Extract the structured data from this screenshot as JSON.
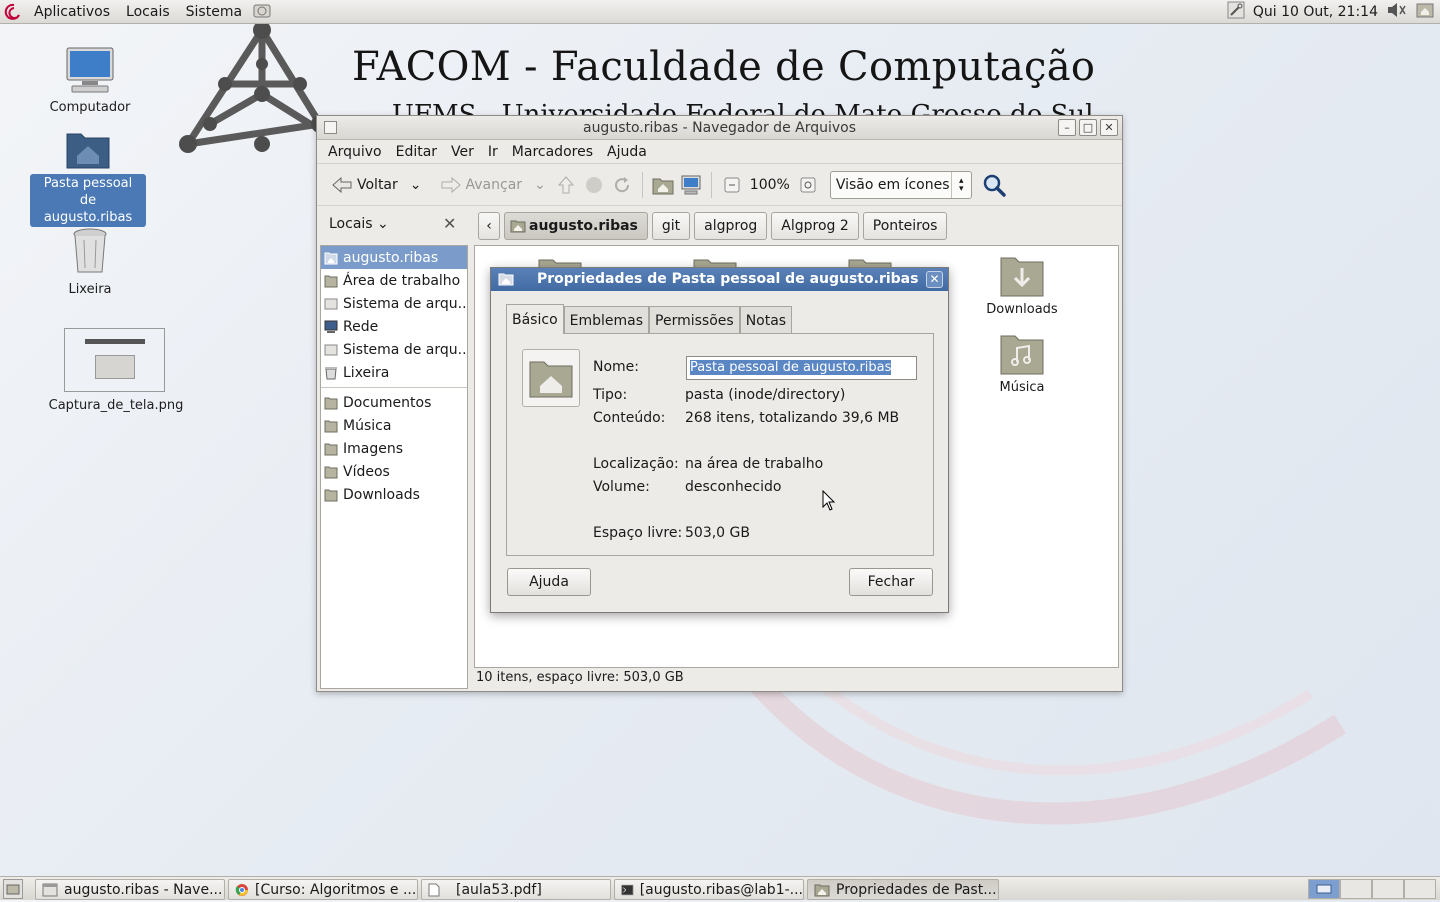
{
  "top_panel": {
    "menus": [
      "Aplicativos",
      "Locais",
      "Sistema"
    ],
    "clock": "Qui 10 Out, 21:14"
  },
  "wallpaper": {
    "title": "FACOM - Faculdade de Computação",
    "subtitle": "UFMS - Universidade Federal de Mato Grosso do Sul"
  },
  "desktop_icons": {
    "computer": "Computador",
    "home_line1": "Pasta pessoal de",
    "home_line2": "augusto.ribas",
    "trash": "Lixeira",
    "screenshot": "Captura_de_tela.png"
  },
  "window": {
    "title": "augusto.ribas - Navegador de Arquivos",
    "menu": [
      "Arquivo",
      "Editar",
      "Ver",
      "Ir",
      "Marcadores",
      "Ajuda"
    ],
    "toolbar": {
      "back": "Voltar",
      "forward": "Avançar",
      "zoom": "100%",
      "view_mode": "Visão em ícones"
    },
    "sidebar_header": "Locais",
    "breadcrumbs": [
      "augusto.ribas",
      "git",
      "algprog",
      "Algprog 2",
      "Ponteiros"
    ],
    "sidebar_items": [
      "augusto.ribas",
      "Área de trabalho",
      "Sistema de arqu...",
      "Rede",
      "Sistema de arqu...",
      "Lixeira",
      "Documentos",
      "Música",
      "Imagens",
      "Vídeos",
      "Downloads"
    ],
    "files": [
      "Downloads",
      "Música"
    ],
    "status": "10 itens, espaço livre: 503,0 GB"
  },
  "dialog": {
    "title": "Propriedades de Pasta pessoal de augusto.ribas",
    "tabs": [
      "Básico",
      "Emblemas",
      "Permissões",
      "Notas"
    ],
    "labels": {
      "name": "Nome:",
      "type": "Tipo:",
      "content": "Conteúdo:",
      "location": "Localização:",
      "volume": "Volume:",
      "free": "Espaço livre:"
    },
    "values": {
      "name": "Pasta pessoal de augusto.ribas",
      "type": "pasta (inode/directory)",
      "content": "268 itens, totalizando 39,6 MB",
      "location": "na área de trabalho",
      "volume": "desconhecido",
      "free": "503,0 GB"
    },
    "help_button": "Ajuda",
    "close_button": "Fechar"
  },
  "taskbar": {
    "tasks": [
      "augusto.ribas - Nave...",
      "[Curso: Algoritmos e ...",
      "[aula53.pdf]",
      "[augusto.ribas@lab1-...",
      "Propriedades de Past..."
    ]
  }
}
